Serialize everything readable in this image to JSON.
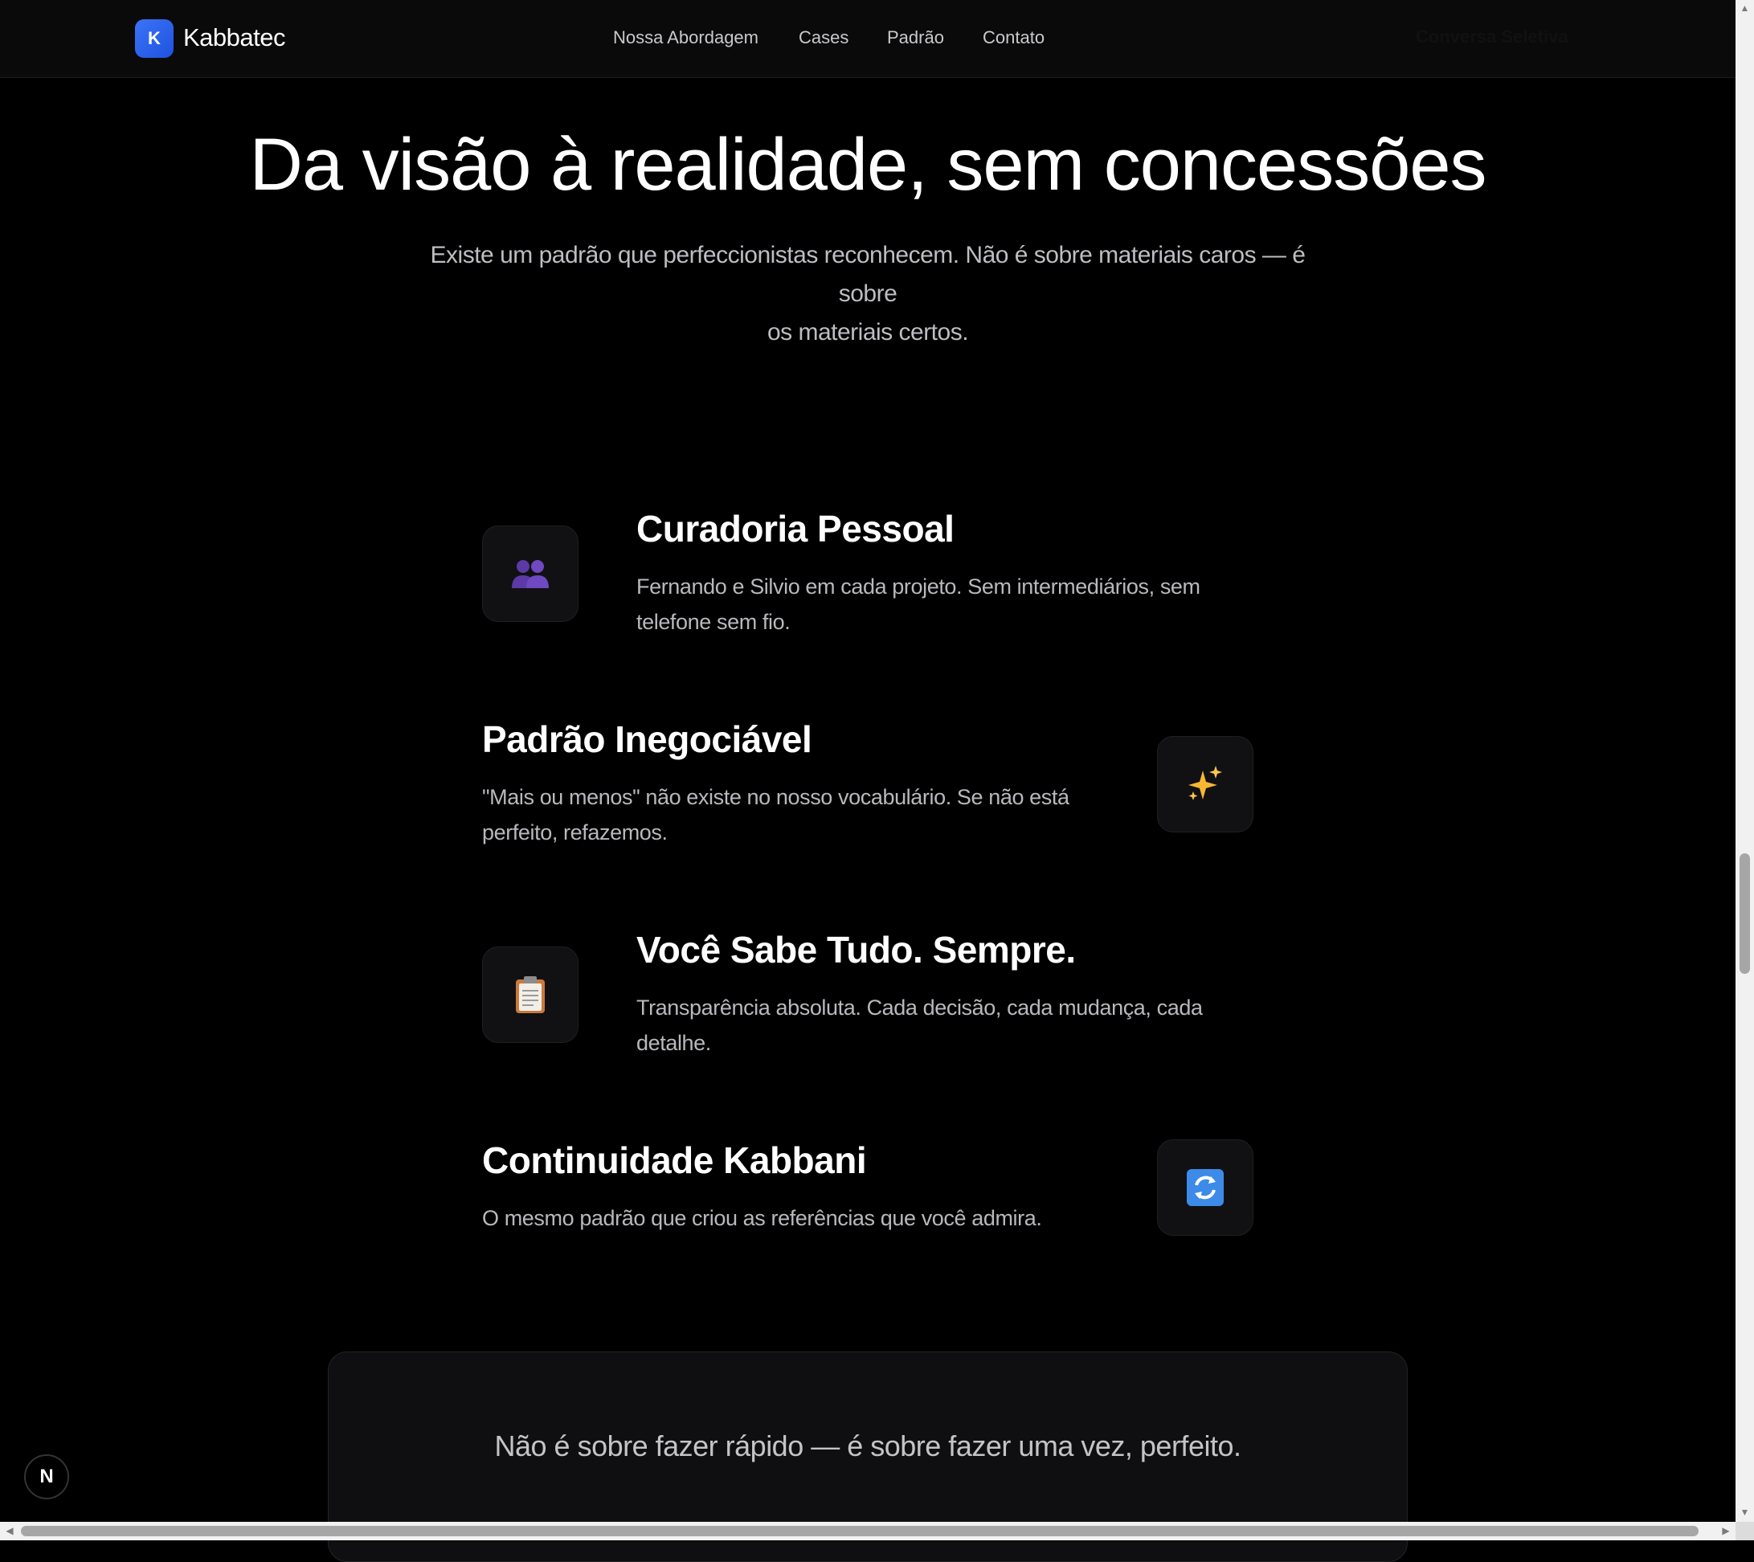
{
  "nav": {
    "logo_letter": "K",
    "brand": "Kabbatec",
    "links": [
      "Nossa Abordagem",
      "Cases",
      "Padrão",
      "Contato"
    ],
    "cta": "Conversa Seletiva"
  },
  "hero": {
    "title": "Da visão à realidade, sem concessões",
    "subtitle_line1": "Existe um padrão que perfeccionistas reconhecem. Não é sobre materiais caros — é sobre",
    "subtitle_line2": "os materiais certos."
  },
  "features": [
    {
      "icon": "busts-in-silhouette-icon",
      "title": "Curadoria Pessoal",
      "desc_line1": "Fernando e Silvio em cada projeto. Sem intermediários, sem",
      "desc_line2": "telefone sem fio."
    },
    {
      "icon": "sparkles-icon",
      "title": "Padrão Inegociável",
      "desc_line1": "\"Mais ou menos\" não existe no nosso vocabulário. Se não está",
      "desc_line2": "perfeito, refazemos."
    },
    {
      "icon": "clipboard-icon",
      "title": "Você Sabe Tudo. Sempre.",
      "desc_line1": "Transparência absoluta. Cada decisão, cada mudança, cada",
      "desc_line2": "detalhe."
    },
    {
      "icon": "refresh-arrows-icon",
      "title": "Continuidade Kabbani",
      "desc_line1": "O mesmo padrão que criou as referências que você admira.",
      "desc_line2": ""
    }
  ],
  "quote": "Não é sobre fazer rápido — é sobre fazer uma vez, perfeito.",
  "dev_badge": "N",
  "colors": {
    "accent": "#2f66f0",
    "background": "#000000",
    "card": "#111113"
  }
}
